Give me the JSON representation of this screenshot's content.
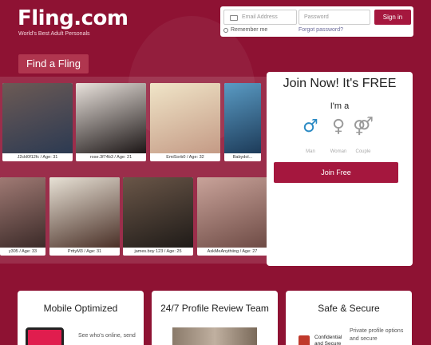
{
  "header": {
    "logo": "Fling.com",
    "tagline": "World's Best Adult Personals"
  },
  "login": {
    "email_placeholder": "Email Address",
    "password_placeholder": "Password",
    "signin_label": "Sign in",
    "remember_label": "Remember me",
    "forgot_label": "Forgot password?"
  },
  "find_fling_label": "Find a Fling",
  "profiles": [
    {
      "caption": "J2ckl0f12fc / Age: 31",
      "color": "#4a3a3a"
    },
    {
      "caption": "rose.3f74b3 / Age: 21",
      "color": "#b08a7a"
    },
    {
      "caption": "EmiSorb0 / Age: 32",
      "color": "#c9a98c"
    },
    {
      "caption": "Babydol... ",
      "color": "#3a6f9a"
    },
    {
      "caption": "y305 / Age: 33",
      "color": "#7a5a56"
    },
    {
      "caption": "PrttyM3 / Age: 31",
      "color": "#3e2a24"
    },
    {
      "caption": "james.boy 123 / Age: 25",
      "color": "#4e3b30"
    },
    {
      "caption": "AskMeAnythiing / Age: 27",
      "color": "#b17f75"
    }
  ],
  "join": {
    "title": "Join Now! It's FREE",
    "im_a": "I'm a",
    "options": [
      {
        "icon": "♂",
        "label": "Man",
        "color": "#2b8ac4"
      },
      {
        "icon": "♀",
        "label": "Woman",
        "color": "#9a9a9a"
      },
      {
        "icon": "⚤",
        "label": "Couple",
        "color": "#9a9a9a"
      }
    ],
    "button_label": "Join Free"
  },
  "features": [
    {
      "title": "Mobile Optimized",
      "text": "See who's online, send"
    },
    {
      "title": "24/7 Profile Review Team",
      "text": ""
    },
    {
      "title": "Safe & Secure",
      "text": "Private profile options and secure",
      "badge": "Confidential and Secure"
    }
  ],
  "colors": {
    "brand": "#a5173e",
    "background": "#8e1233"
  }
}
